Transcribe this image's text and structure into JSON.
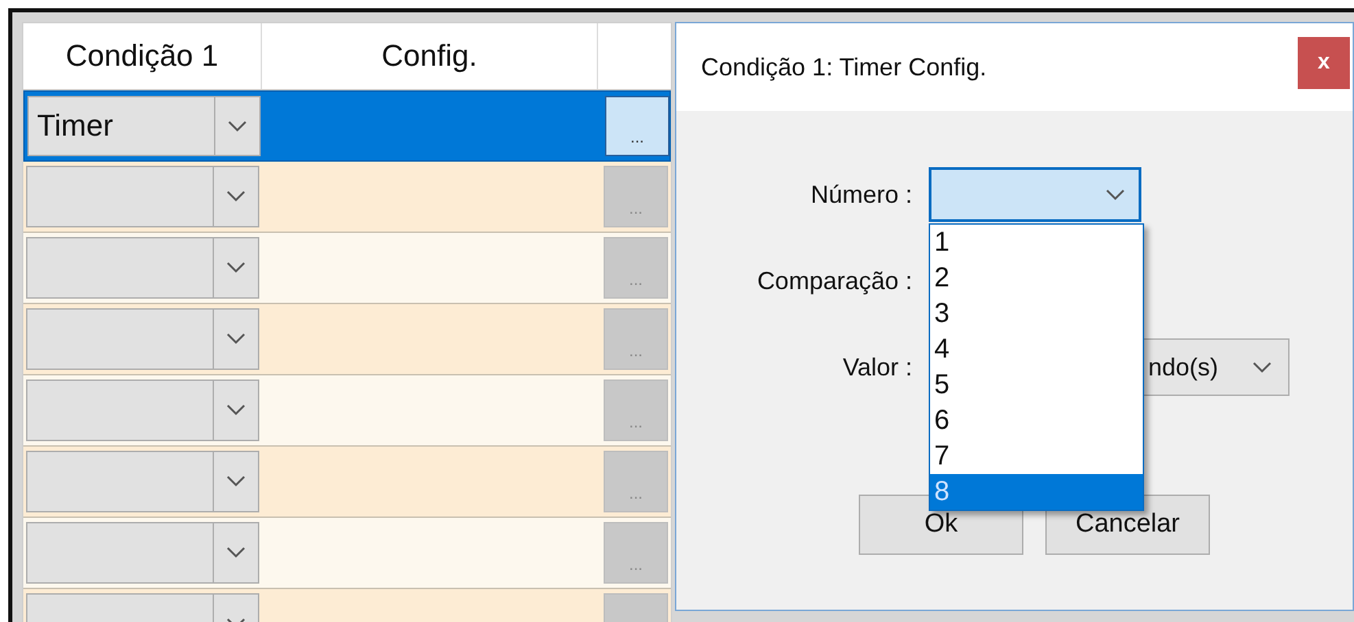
{
  "grid": {
    "columns": [
      "Condição 1",
      "Config."
    ],
    "rows": [
      {
        "condition": "Timer",
        "selected": true,
        "config_button": "..."
      },
      {
        "selected": false,
        "config_button": "..."
      },
      {
        "selected": false,
        "config_button": "..."
      },
      {
        "selected": false,
        "config_button": "..."
      },
      {
        "selected": false,
        "config_button": "..."
      },
      {
        "selected": false,
        "config_button": "..."
      },
      {
        "selected": false,
        "config_button": "..."
      },
      {
        "selected": false
      }
    ]
  },
  "dialog": {
    "title": "Condição 1: Timer Config.",
    "close": "x",
    "numero": {
      "label": "Número :"
    },
    "comparacao": {
      "label": "Comparação :"
    },
    "valor": {
      "label": "Valor :",
      "unit": "ndo(s)"
    },
    "dropdown_options": [
      {
        "label": "1",
        "selected": false
      },
      {
        "label": "2",
        "selected": false
      },
      {
        "label": "3",
        "selected": false
      },
      {
        "label": "4",
        "selected": false
      },
      {
        "label": "5",
        "selected": false
      },
      {
        "label": "6",
        "selected": false
      },
      {
        "label": "7",
        "selected": false
      },
      {
        "label": "8",
        "selected": true
      }
    ],
    "buttons": [
      "Ok",
      "Cancelar"
    ]
  }
}
